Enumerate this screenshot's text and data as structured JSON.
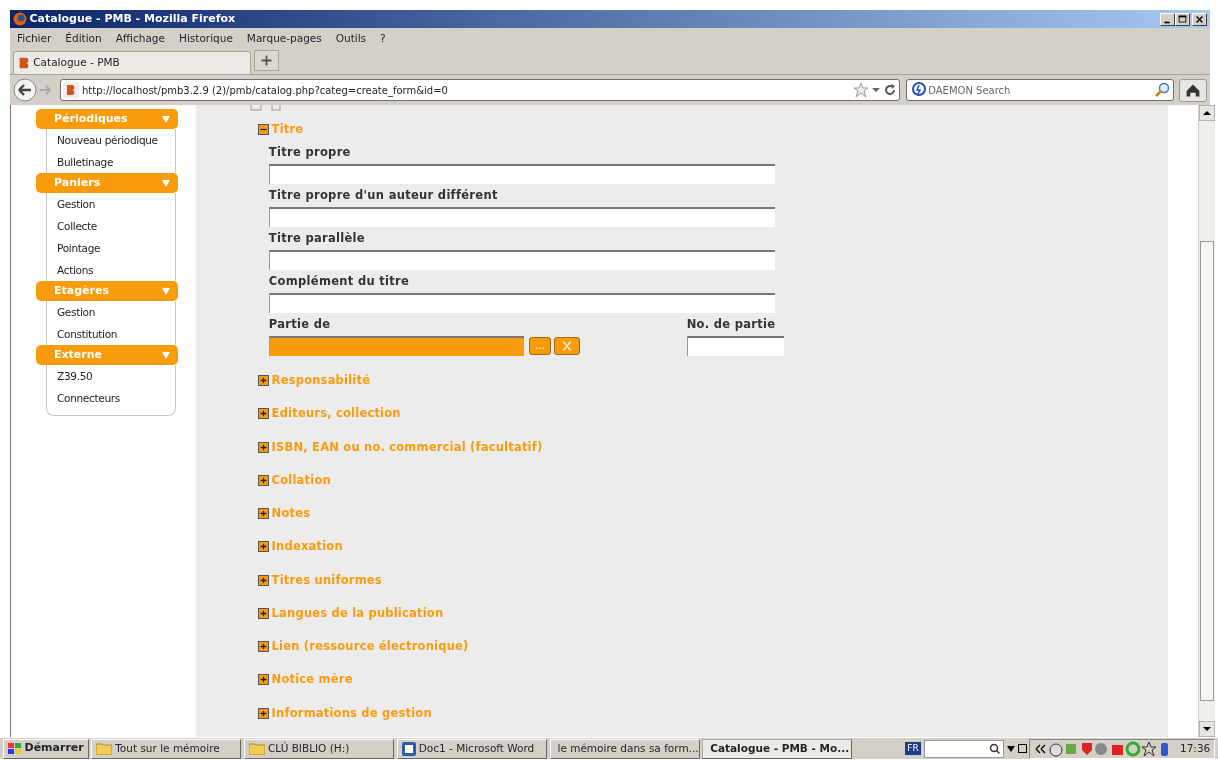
{
  "window": {
    "title": "Catalogue - PMB - Mozilla Firefox"
  },
  "menu": [
    "Fichier",
    "Édition",
    "Affichage",
    "Historique",
    "Marque-pages",
    "Outils",
    "?"
  ],
  "tabs": [
    {
      "label": "Catalogue - PMB",
      "selected": true
    }
  ],
  "address_bar": {
    "url": "http://localhost/pmb3.2.9 (2)/pmb/catalog.php?categ=create_form&id=0"
  },
  "search": {
    "placeholder": "DAEMON Search"
  },
  "sidebar": {
    "groups": [
      {
        "title": "Périodiques",
        "items": [
          "Nouveau périodique",
          "Bulletinage"
        ]
      },
      {
        "title": "Paniers",
        "items": [
          "Gestion",
          "Collecte",
          "Pointage",
          "Actions"
        ]
      },
      {
        "title": "Etagères",
        "items": [
          "Gestion",
          "Constitution"
        ]
      },
      {
        "title": "Externe",
        "items": [
          "Z39.50",
          "Connecteurs"
        ]
      }
    ]
  },
  "form": {
    "sections": [
      {
        "title": "Titre",
        "expanded": true,
        "rows": [
          [
            {
              "label": "Titre propre",
              "kind": "text"
            }
          ],
          [
            {
              "label": "Titre propre d'un auteur différent",
              "kind": "text"
            }
          ],
          [
            {
              "label": "Titre parallèle",
              "kind": "text"
            }
          ],
          [
            {
              "label": "Complément du titre",
              "kind": "text"
            }
          ],
          [
            {
              "label": "Partie de",
              "kind": "lookup",
              "button": "..."
            },
            {
              "label": "No. de partie",
              "kind": "short"
            }
          ]
        ]
      },
      {
        "title": "Responsabilité",
        "expanded": false
      },
      {
        "title": "Editeurs, collection",
        "expanded": false
      },
      {
        "title": "ISBN, EAN ou no. commercial (facultatif)",
        "expanded": false
      },
      {
        "title": "Collation",
        "expanded": false
      },
      {
        "title": "Notes",
        "expanded": false
      },
      {
        "title": "Indexation",
        "expanded": false
      },
      {
        "title": "Titres uniformes",
        "expanded": false
      },
      {
        "title": "Langues de la publication",
        "expanded": false
      },
      {
        "title": "Lien (ressource électronique)",
        "expanded": false
      },
      {
        "title": "Notice mère",
        "expanded": false
      },
      {
        "title": "Informations de gestion",
        "expanded": false
      }
    ]
  },
  "taskbar": {
    "start": "Démarrer",
    "tasks": [
      {
        "label": "Tout sur le mémoire",
        "kind": "folder",
        "selected": false
      },
      {
        "label": "CLÚ BIBLIO (H:)",
        "kind": "folder",
        "selected": false
      },
      {
        "label": "Doc1 - Microsoft Word",
        "kind": "word",
        "selected": false
      },
      {
        "label": "le mémoire dans sa form...",
        "kind": "word",
        "selected": false
      },
      {
        "label": "Catalogue - PMB - Mo...",
        "kind": "firefox",
        "selected": true
      }
    ],
    "language": "FR",
    "clock": "17:36"
  }
}
